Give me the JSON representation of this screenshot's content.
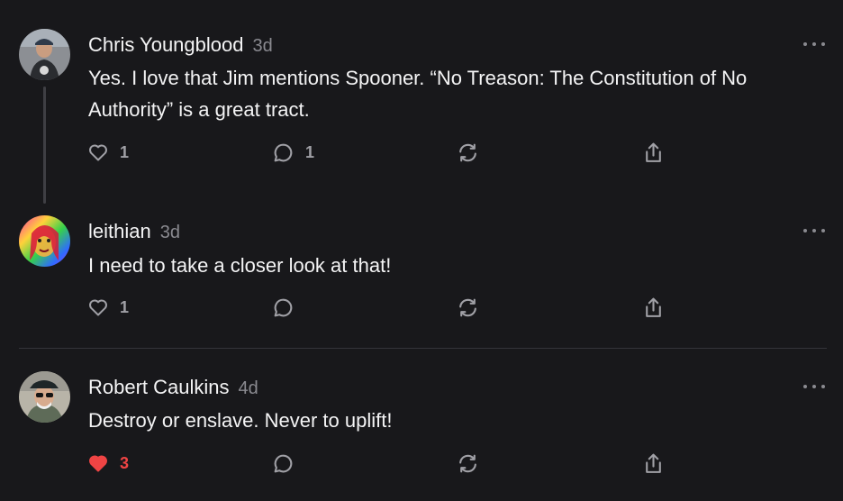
{
  "comments": [
    {
      "author": "Chris Youngblood",
      "time": "3d",
      "text": "Yes. I love that Jim mentions Spooner. “No Treason: The Constitution of No Authority” is a great tract.",
      "likes": "1",
      "replies": "1",
      "liked": false
    },
    {
      "author": "leithian",
      "time": "3d",
      "text": "I need to take a closer look at that!",
      "likes": "1",
      "replies": "",
      "liked": false
    },
    {
      "author": "Robert Caulkins",
      "time": "4d",
      "text": "Destroy or enslave. Never to uplift!",
      "likes": "3",
      "replies": "",
      "liked": true
    }
  ],
  "colors": {
    "background": "#18181b",
    "text": "#f4f4f5",
    "muted": "#8a8a90",
    "like_active": "#ef4444"
  },
  "icons": [
    "more-horizontal-icon",
    "heart-icon",
    "comment-bubble-icon",
    "restack-icon",
    "share-icon"
  ]
}
